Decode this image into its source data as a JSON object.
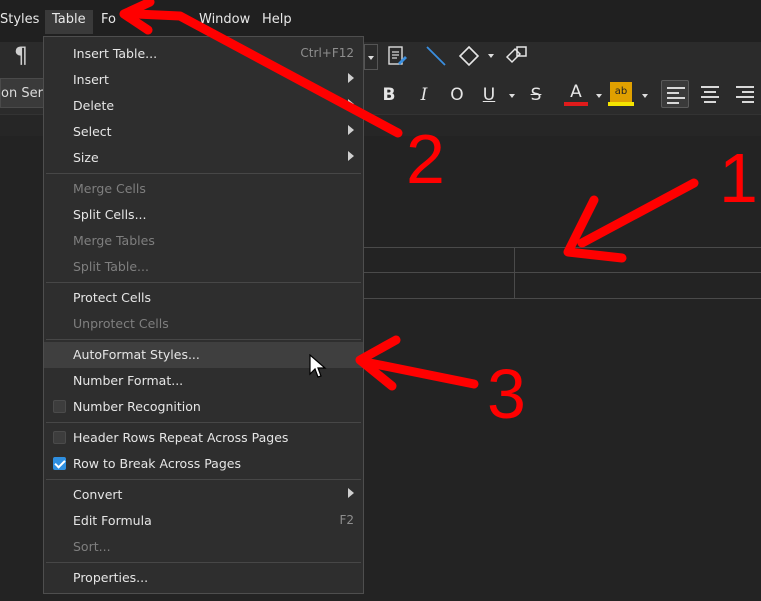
{
  "menubar": {
    "items": [
      "Styles",
      "Table",
      "Fo",
      "Window",
      "Help"
    ],
    "active": "Table"
  },
  "toolbar": {
    "font_name": "on Serif",
    "pilcrow": "¶",
    "bold": "B",
    "italic": "I",
    "outline": "O",
    "underline": "U",
    "strike": "S",
    "font_color": "A",
    "highlight": "ab",
    "colors": {
      "font_color_bar": "#e01b1b",
      "highlight_bar": "#f5e400"
    }
  },
  "menu": {
    "items": [
      {
        "label": "Insert Table...",
        "shortcut": "Ctrl+F12"
      },
      {
        "label": "Insert",
        "submenu": true
      },
      {
        "label": "Delete",
        "submenu": true
      },
      {
        "label": "Select",
        "submenu": true
      },
      {
        "label": "Size",
        "submenu": true
      },
      {
        "label": "Merge Cells",
        "disabled": true
      },
      {
        "label": "Split Cells..."
      },
      {
        "label": "Merge Tables",
        "disabled": true
      },
      {
        "label": "Split Table...",
        "disabled": true
      },
      {
        "label": "Protect Cells"
      },
      {
        "label": "Unprotect Cells",
        "disabled": true
      },
      {
        "label": "AutoFormat Styles...",
        "highlighted": true
      },
      {
        "label": "Number Format..."
      },
      {
        "label": "Number Recognition",
        "checkbox": false
      },
      {
        "label": "Header Rows Repeat Across Pages",
        "checkbox": false
      },
      {
        "label": "Row to Break Across Pages",
        "checkbox": true
      },
      {
        "label": "Convert",
        "submenu": true
      },
      {
        "label": "Edit Formula",
        "shortcut": "F2"
      },
      {
        "label": "Sort...",
        "disabled": true
      },
      {
        "label": "Properties..."
      }
    ]
  },
  "annotations": {
    "numbers": [
      "1",
      "2",
      "3"
    ],
    "color": "#ff0000"
  }
}
